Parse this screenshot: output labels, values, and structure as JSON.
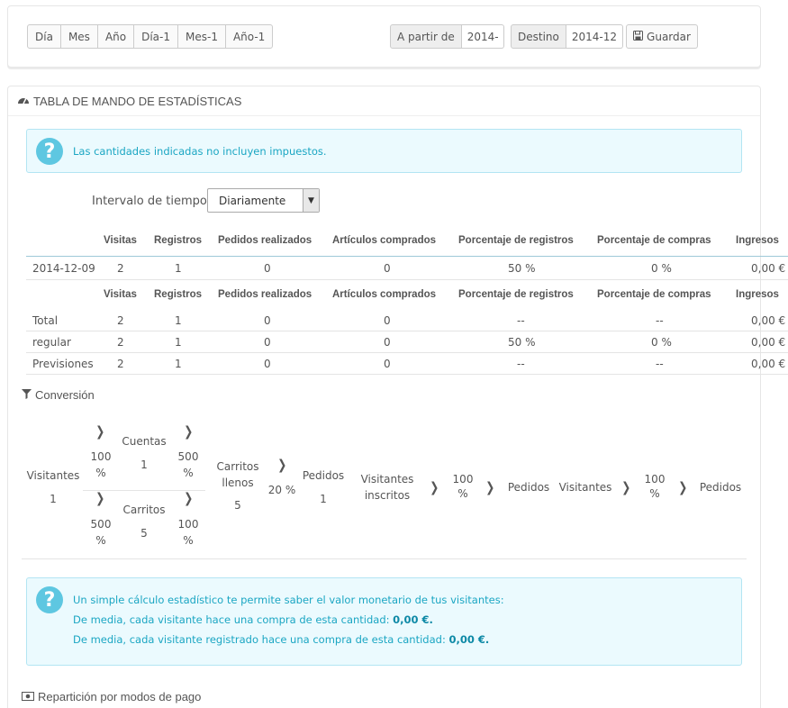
{
  "period_buttons": [
    "Día",
    "Mes",
    "Año",
    "Día-1",
    "Mes-1",
    "Año-1"
  ],
  "date_from": {
    "label": "A partir de",
    "value": "2014-"
  },
  "date_to": {
    "label": "Destino",
    "value": "2014-12"
  },
  "save_label": "Guardar",
  "panel_title": "TABLA DE MANDO DE ESTADÍSTICAS",
  "tax_notice": "Las cantidades indicadas no incluyen impuestos.",
  "interval": {
    "label": "Intervalo de tiempo",
    "selected": "Diariamente"
  },
  "table": {
    "headers": [
      "Visitas",
      "Registros",
      "Pedidos realizados",
      "Artículos comprados",
      "Porcentaje de registros",
      "Porcentaje de compras",
      "Ingresos"
    ],
    "rows": [
      [
        "2014-12-09",
        "2",
        "1",
        "0",
        "0",
        "50 %",
        "0 %",
        "0,00 €"
      ]
    ],
    "summary_rows": [
      [
        "Total",
        "2",
        "1",
        "0",
        "0",
        "--",
        "--",
        "0,00 €"
      ],
      [
        "regular",
        "2",
        "1",
        "0",
        "0",
        "50 %",
        "0 %",
        "0,00 €"
      ],
      [
        "Previsiones",
        "2",
        "1",
        "0",
        "0",
        "--",
        "--",
        "0,00 €"
      ]
    ]
  },
  "conversion": {
    "title": "Conversión",
    "visitors_label": "Visitantes",
    "visitors_value": "1",
    "pct_visitors_accounts": "100 %",
    "accounts_label": "Cuentas",
    "accounts_value": "1",
    "pct_accounts_carts": "500 %",
    "pct_visitors_carts": "500 %",
    "carts_label": "Carritos",
    "carts_value": "5",
    "pct_carts_full": "100 %",
    "full_carts_label": "Carritos llenos",
    "full_carts_value": "5",
    "pct_full_orders": "20 %",
    "orders_label": "Pedidos",
    "orders_value": "1",
    "registered_label": "Visitantes inscritos",
    "pct_registered_orders": "100 %",
    "orders_label_2": "Pedidos",
    "visitors_label_2": "Visitantes",
    "pct_visitors_orders": "100 %",
    "orders_label_3": "Pedidos"
  },
  "value_notice": {
    "line1": "Un simple cálculo estadístico te permite saber el valor monetario de tus visitantes:",
    "line2": "De media, cada visitante hace una compra de esta cantidad:",
    "line2_value": "0,00 €.",
    "line3": "De media, cada visitante registrado hace una compra de esta cantidad:",
    "line3_value": "0,00 €."
  },
  "payment_title": "Repartición por modos de pago",
  "icons": {
    "save": "floppy-disk-icon",
    "dashboard": "dashboard-gauge-icon",
    "filter": "funnel-filter-icon",
    "money": "money-bill-icon",
    "question": "question-circle-icon",
    "chevron": "chevron-right-icon",
    "select_arrow": "caret-down-icon"
  },
  "colors": {
    "alert_bg": "#ebfafe",
    "alert_text": "#1ba6c3",
    "alert_icon": "#5ec7e1"
  }
}
